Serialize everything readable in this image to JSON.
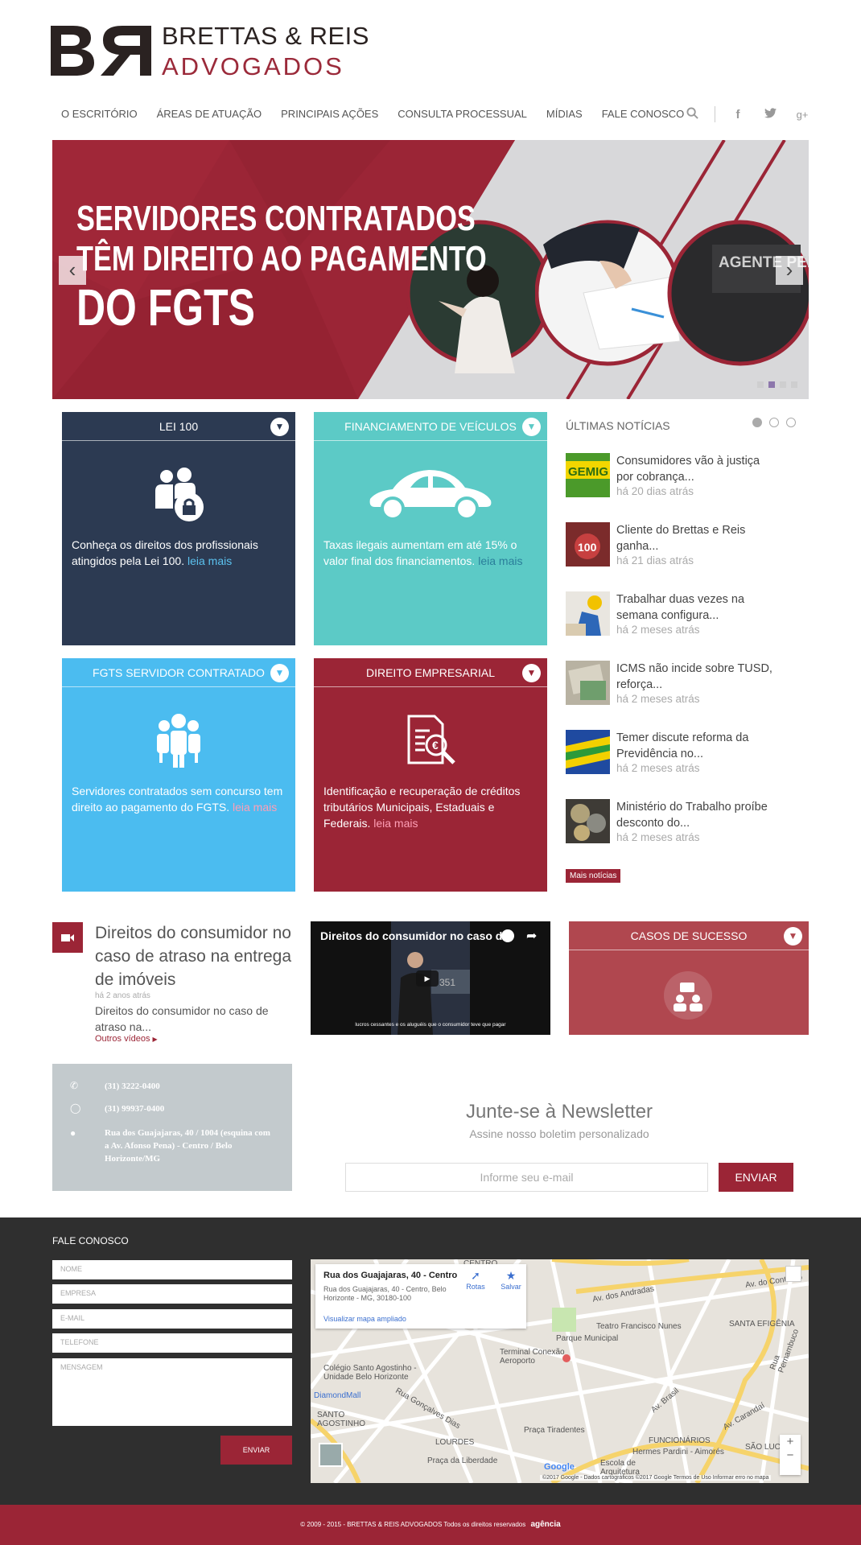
{
  "brand": {
    "line1": "BRETTAS & REIS",
    "line2": "ADVOGADOS"
  },
  "nav": {
    "items": [
      "O ESCRITÓRIO",
      "ÁREAS DE ATUAÇÃO",
      "PRINCIPAIS AÇÕES",
      "CONSULTA PROCESSUAL",
      "MÍDIAS",
      "FALE CONOSCO"
    ]
  },
  "hero": {
    "line1": "SERVIDORES CONTRATADOS",
    "line2": "TÊM DIREITO AO PAGAMENTO",
    "line3": "DO FGTS",
    "slide_badge": "AGENTE PENITENCIÁRIO",
    "prev": "‹",
    "next": "›"
  },
  "cards": [
    {
      "title": "LEI 100",
      "text": "Conheça os direitos dos profissionais atingidos pela Lei 100.",
      "more": "leia mais",
      "color": "#2c3a52"
    },
    {
      "title": "FINANCIAMENTO DE VEÍCULOS",
      "text": "Taxas ilegais aumentam em até 15% o valor final dos financiamentos.",
      "more": "leia mais",
      "color": "#5ccac6"
    },
    {
      "title": "FGTS SERVIDOR CONTRATADO",
      "text": "Servidores contratados sem concurso tem direito ao pagamento do FGTS.",
      "more": "leia mais",
      "color": "#4bbcf0"
    },
    {
      "title": "DIREITO EMPRESARIAL",
      "text": "Identificação e recuperação de créditos tributários Municipais, Estaduais e Federais.",
      "more": "leia mais",
      "color": "#9b2536"
    }
  ],
  "news": {
    "title": "ÚLTIMAS NOTÍCIAS",
    "items": [
      {
        "headline": "Consumidores vão à justiça por cobrança...",
        "time": "há 20 dias atrás"
      },
      {
        "headline": "Cliente do Brettas e Reis ganha...",
        "time": "há 21 dias atrás"
      },
      {
        "headline": "Trabalhar duas vezes na semana configura...",
        "time": "há 2 meses atrás"
      },
      {
        "headline": "ICMS não incide sobre TUSD, reforça...",
        "time": "há 2 meses atrás"
      },
      {
        "headline": "Temer discute reforma da Previdência no...",
        "time": "há 2 meses atrás"
      },
      {
        "headline": "Ministério do Trabalho proíbe desconto do...",
        "time": "há 2 meses atrás"
      }
    ],
    "more_button": "Mais notícias",
    "thumb_label_1": "GEMIG",
    "thumb_label_2": "100"
  },
  "video": {
    "title": "Direitos do consumidor no caso de atraso na entrega de imóveis",
    "date": "há 2 anos atrás",
    "desc": "Direitos do consumidor no caso de atraso na...",
    "more": "Outros vídeos",
    "player_title": "Direitos do consumidor no caso d...",
    "caption": "lucros cessantes e os aluguéis que o consumidor teve que pagar",
    "screen_num": "351"
  },
  "casos": {
    "title": "CASOS DE SUCESSO"
  },
  "contact": {
    "phone": "(31) 3222-0400",
    "whatsapp": "(31) 99937-0400",
    "address": "Rua dos Guajajaras, 40 / 1004 (esquina com a Av. Afonso Pena) - Centro / Belo Horizonte/MG"
  },
  "newsletter": {
    "title": "Junte-se à Newsletter",
    "subtitle": "Assine nosso boletim personalizado",
    "placeholder": "Informe seu e-mail",
    "button": "ENVIAR"
  },
  "footer_form": {
    "title": "FALE CONOSCO",
    "fields": [
      "NOME",
      "EMPRESA",
      "E-MAIL",
      "TELEFONE"
    ],
    "message": "MENSAGEM",
    "button": "ENVIAR"
  },
  "map": {
    "place": "Rua dos Guajajaras, 40 - Centro",
    "address": "Rua dos Guajajaras, 40 - Centro, Belo Horizonte - MG, 30180-100",
    "directions": "Rotas",
    "save": "Salvar",
    "larger": "Visualizar mapa ampliado",
    "labels": [
      "Av. dos Andradas",
      "Av. do Contorno",
      "SANTA EFIGÊNIA",
      "Teatro Francisco Nunes",
      "Parque Municipal",
      "Terminal Conexão Aeroporto",
      "Colégio Santo Agostinho - Unidade Belo Horizonte",
      "DiamondMall",
      "SANTO AGOSTINHO",
      "Praça Tiradentes",
      "FUNCIONÁRIOS",
      "Hermes Pardini - Aimorés",
      "LOURDES",
      "Praça da Liberdade",
      "SÃO LUCAS",
      "Escola de Arquitetura",
      "CENTRO",
      "Av. Brasil",
      "Av. Carandaí",
      "Rua Pernambuco",
      "Rua Gonçalves Dias"
    ],
    "attribution": "©2017 Google - Dados cartográficos ©2017 Google    Termos de Uso    Informar erro no mapa",
    "google": "Google",
    "zoom_in": "+",
    "zoom_out": "−"
  },
  "bottom": {
    "copyright": "© 2009 - 2015 - BRETTAS & REIS ADVOGADOS Todos os direitos reservados",
    "agency": "agência"
  }
}
